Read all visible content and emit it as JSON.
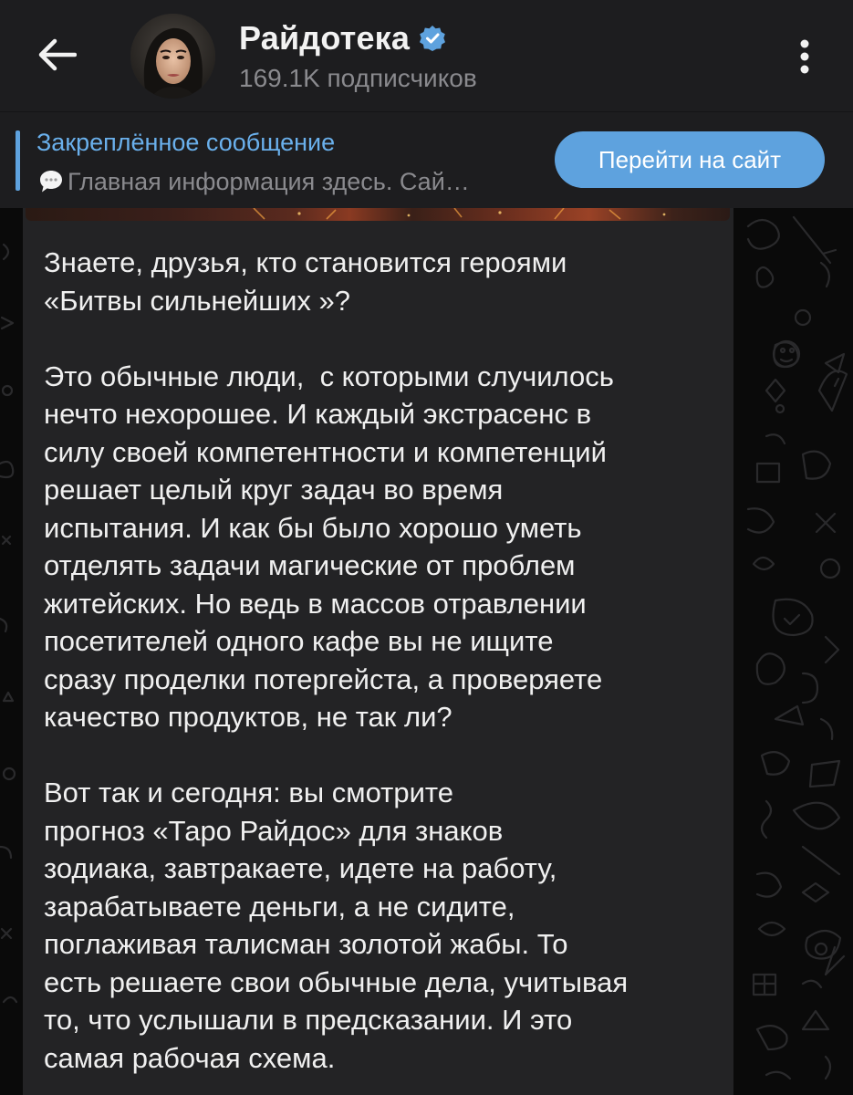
{
  "header": {
    "back_icon": "arrow-left-icon",
    "title": "Райдотека",
    "verified_icon": "verified-badge-icon",
    "subscribers": "169.1K подписчиков",
    "menu_icon": "more-vertical-icon"
  },
  "pinned": {
    "title": "Закреплённое сообщение",
    "icon": "speech-bubble-icon",
    "preview": "Главная информация здесь. Сай…",
    "button_label": "Перейти на сайт"
  },
  "message": {
    "text": "Знаете, друзья, кто становится героями\n«Битвы сильнейших »?\n\nЭто обычные люди,  с которыми случилось\nнечто нехорошее. И каждый экстрасенс в\nсилу своей компетентности и компетенций\nрешает целый круг задач во время\nиспытания. И как бы было хорошо уметь\nотделять задачи магические от проблем\nжитейских. Но ведь в массов отравлении\nпосетителей одного кафе вы не ищите\nсразу проделки потергейста, а проверяете\nкачество продуктов, не так ли?\n\nВот так и сегодня: вы смотрите\nпрогноз «Таро Райдос» для знаков\nзодиака, завтракаете, идете на работу,\nзарабатываете деньги, а не сидите,\nпоглаживая талисман золотой жабы. То\nесть решаете свои обычные дела, учитывая\nто, что услышали в предсказании. И это\nсамая рабочая схема."
  },
  "colors": {
    "background": "#0a0a0a",
    "bar": "#1d1d1f",
    "bubble": "#232325",
    "accent": "#5ea2de",
    "pinned_title": "#6ab0ec",
    "muted_text": "#8a8a8e",
    "text": "#f0f0f0"
  }
}
